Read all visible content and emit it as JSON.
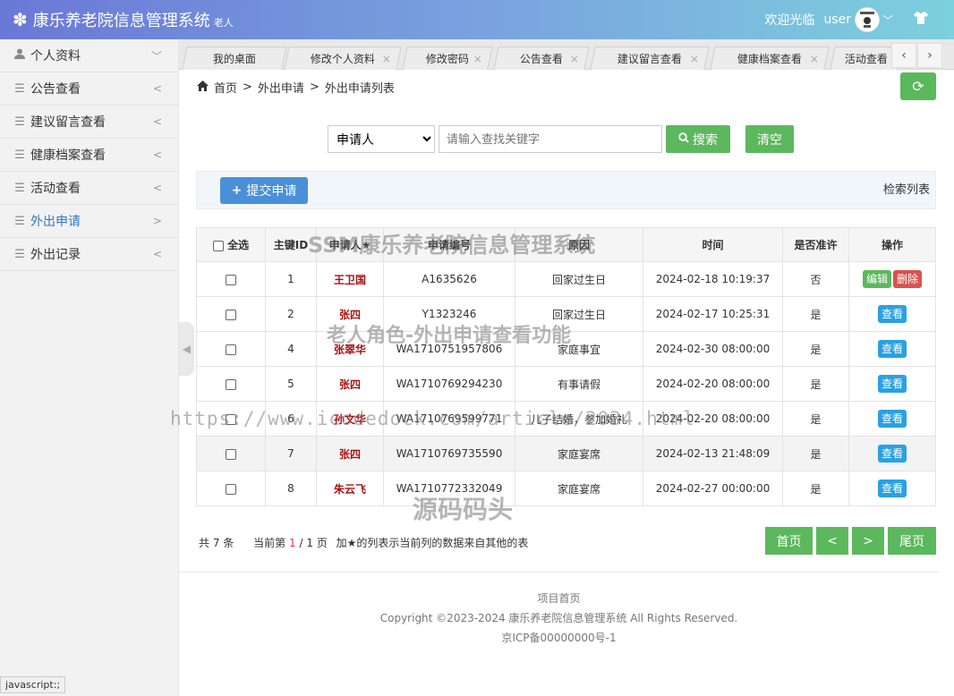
{
  "header": {
    "title": "康乐养老院信息管理系统",
    "role": "老人",
    "welcome": "欢迎光临",
    "username": "user",
    "avatar_text": "小孩在等\n嗒"
  },
  "sidebar": {
    "items": [
      {
        "label": "个人资料",
        "icon": "user-icon",
        "arrow": "﹀"
      },
      {
        "label": "公告查看",
        "icon": "menu-icon",
        "arrow": "<"
      },
      {
        "label": "建议留言查看",
        "icon": "menu-icon",
        "arrow": "<"
      },
      {
        "label": "健康档案查看",
        "icon": "menu-icon",
        "arrow": "<"
      },
      {
        "label": "活动查看",
        "icon": "menu-icon",
        "arrow": "<"
      },
      {
        "label": "外出申请",
        "icon": "menu-icon",
        "arrow": ">"
      },
      {
        "label": "外出记录",
        "icon": "menu-icon",
        "arrow": "<"
      }
    ],
    "active": "外出申请"
  },
  "tabs": [
    {
      "label": "我的桌面",
      "closable": false
    },
    {
      "label": "修改个人资料",
      "closable": true
    },
    {
      "label": "修改密码",
      "closable": true
    },
    {
      "label": "公告查看",
      "closable": true
    },
    {
      "label": "建议留言查看",
      "closable": true
    },
    {
      "label": "健康档案查看",
      "closable": true
    },
    {
      "label": "活动查看",
      "closable": false
    }
  ],
  "breadcrumb": {
    "home": "首页",
    "level1": "外出申请",
    "level2": "外出申请列表",
    "sep": ">"
  },
  "search": {
    "field_selected": "申请人",
    "placeholder": "请输入查找关键字",
    "search_label": "搜索",
    "clear_label": "清空"
  },
  "actions": {
    "submit_label": "提交申请",
    "list_title": "检索列表"
  },
  "table": {
    "headers": {
      "select_all": "全选",
      "id": "主键ID",
      "applicant": "申请人★",
      "number": "申请编号",
      "reason": "原因",
      "time": "时间",
      "approved": "是否准许",
      "ops": "操作"
    },
    "rows": [
      {
        "id": "1",
        "applicant": "王卫国",
        "number": "A1635626",
        "reason": "回家过生日",
        "time": "2024-02-18 10:19:37",
        "approved": "否"
      },
      {
        "id": "2",
        "applicant": "张四",
        "number": "Y1323246",
        "reason": "回家过生日",
        "time": "2024-02-17 10:25:31",
        "approved": "是"
      },
      {
        "id": "4",
        "applicant": "张翠华",
        "number": "WA1710751957806",
        "reason": "家庭事宜",
        "time": "2024-02-30 08:00:00",
        "approved": "是"
      },
      {
        "id": "5",
        "applicant": "张四",
        "number": "WA1710769294230",
        "reason": "有事请假",
        "time": "2024-02-20 08:00:00",
        "approved": "是"
      },
      {
        "id": "6",
        "applicant": "孙文华",
        "number": "WA1710769599771",
        "reason": "儿子结婚，参加婚礼",
        "time": "2024-02-20 08:00:00",
        "approved": "是"
      },
      {
        "id": "7",
        "applicant": "张四",
        "number": "WA1710769735590",
        "reason": "家庭宴席",
        "time": "2024-02-13 21:48:09",
        "approved": "是"
      },
      {
        "id": "8",
        "applicant": "朱云飞",
        "number": "WA1710772332049",
        "reason": "家庭宴席",
        "time": "2024-02-27 00:00:00",
        "approved": "是"
      }
    ],
    "op_edit": "编辑",
    "op_delete": "删除",
    "op_view": "查看"
  },
  "pagination": {
    "total_prefix": "共",
    "total": "7",
    "total_suffix": "条",
    "current_prefix": "当前第",
    "current": "1",
    "slash": "/",
    "pages": "1",
    "pages_suffix": "页",
    "note": "加★的列表示当前列的数据来自其他的表",
    "first": "首页",
    "prev": "<",
    "next": ">",
    "last": "尾页"
  },
  "footer": {
    "home_link": "项目首页",
    "copyright": "Copyright ©2023-2024 康乐养老院信息管理系统 All Rights Reserved.",
    "icp": "京ICP备00000000号-1"
  },
  "status_bar": "javascript:;",
  "watermarks": {
    "line1": "SSM康乐养老院信息管理系统",
    "line2": "老人角色-外出申请查看功能",
    "line3": "https://www.icodedock.com/article/2034.html",
    "line4": "源码码头"
  },
  "colors": {
    "accent_green": "#5cb85c",
    "accent_blue": "#4a90d9",
    "danger": "#d9534f",
    "info": "#2aa1e3",
    "name_red": "#aa1111"
  }
}
